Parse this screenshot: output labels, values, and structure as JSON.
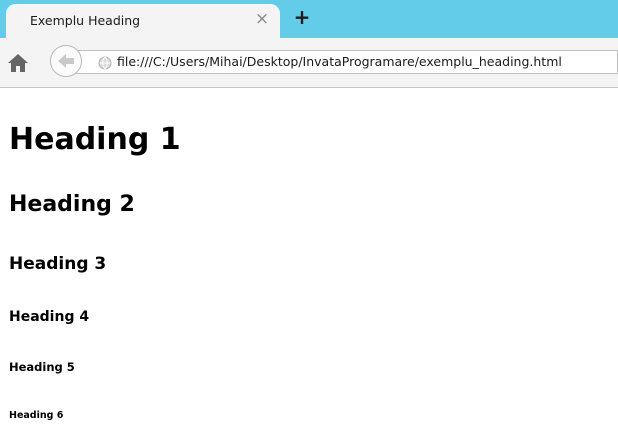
{
  "tab": {
    "title": "Exemplu Heading",
    "close_glyph": "×"
  },
  "new_tab_glyph": "+",
  "address_bar": {
    "url": "file:///C:/Users/Mihai/Desktop/InvataProgramare/exemplu_heading.html"
  },
  "icons": {
    "home": "home-icon",
    "back": "back-arrow-icon",
    "site_identity": "globe-icon"
  },
  "page": {
    "headings": [
      "Heading 1",
      "Heading 2",
      "Heading 3",
      "Heading 4",
      "Heading 5",
      "Heading 6"
    ]
  },
  "colors": {
    "tabstrip": "#63cce9",
    "toolbar": "#f4f4f4",
    "back_arrow": "#63b2e0"
  }
}
